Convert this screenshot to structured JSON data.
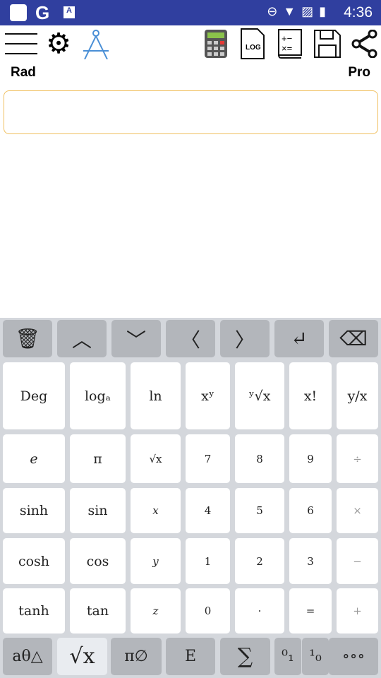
{
  "status_bar": {
    "time": "4:36",
    "google": "G",
    "icons": [
      "app-icon",
      "google-icon",
      "translate-icon",
      "dnd-icon",
      "wifi-icon",
      "no-sim-icon",
      "battery-charging-icon"
    ]
  },
  "toolbar": {
    "icons": [
      "menu-icon",
      "settings-icon",
      "compass-icon",
      "calculator-icon",
      "log-icon",
      "formula-book-icon",
      "save-icon",
      "share-icon"
    ],
    "log_label": "LOG"
  },
  "mode": {
    "angle": "Rad",
    "edition": "Pro"
  },
  "input": {
    "value": ""
  },
  "keyboard": {
    "nav": [
      {
        "name": "delete-all",
        "icon": "trash-icon",
        "label": "🗑"
      },
      {
        "name": "up",
        "icon": "chevron-up-icon",
        "label": "︿"
      },
      {
        "name": "down",
        "icon": "chevron-down-icon",
        "label": "﹀"
      },
      {
        "name": "left",
        "icon": "chevron-left-icon",
        "label": "〈"
      },
      {
        "name": "right",
        "icon": "chevron-right-icon",
        "label": "〉"
      },
      {
        "name": "enter",
        "icon": "enter-icon",
        "label": "↵"
      },
      {
        "name": "backspace",
        "icon": "backspace-icon",
        "label": "⌫"
      }
    ],
    "rows": [
      [
        "Deg",
        "logₐ",
        "ln",
        "xʸ",
        "ʸ√x",
        "x!",
        "y/x"
      ],
      [
        "e",
        "π",
        "√x",
        "7",
        "8",
        "9",
        "÷"
      ],
      [
        "sinh",
        "sin",
        "x",
        "4",
        "5",
        "6",
        "×"
      ],
      [
        "cosh",
        "cos",
        "y",
        "1",
        "2",
        "3",
        "−"
      ],
      [
        "tanh",
        "tan",
        "z",
        "0",
        "·",
        "=",
        "+"
      ]
    ],
    "bottom": [
      "aθ△",
      "√x",
      "π∅",
      "E",
      "∑",
      "⁰₁",
      "¹₀",
      "∘∘∘"
    ],
    "selected_bottom": 1
  }
}
